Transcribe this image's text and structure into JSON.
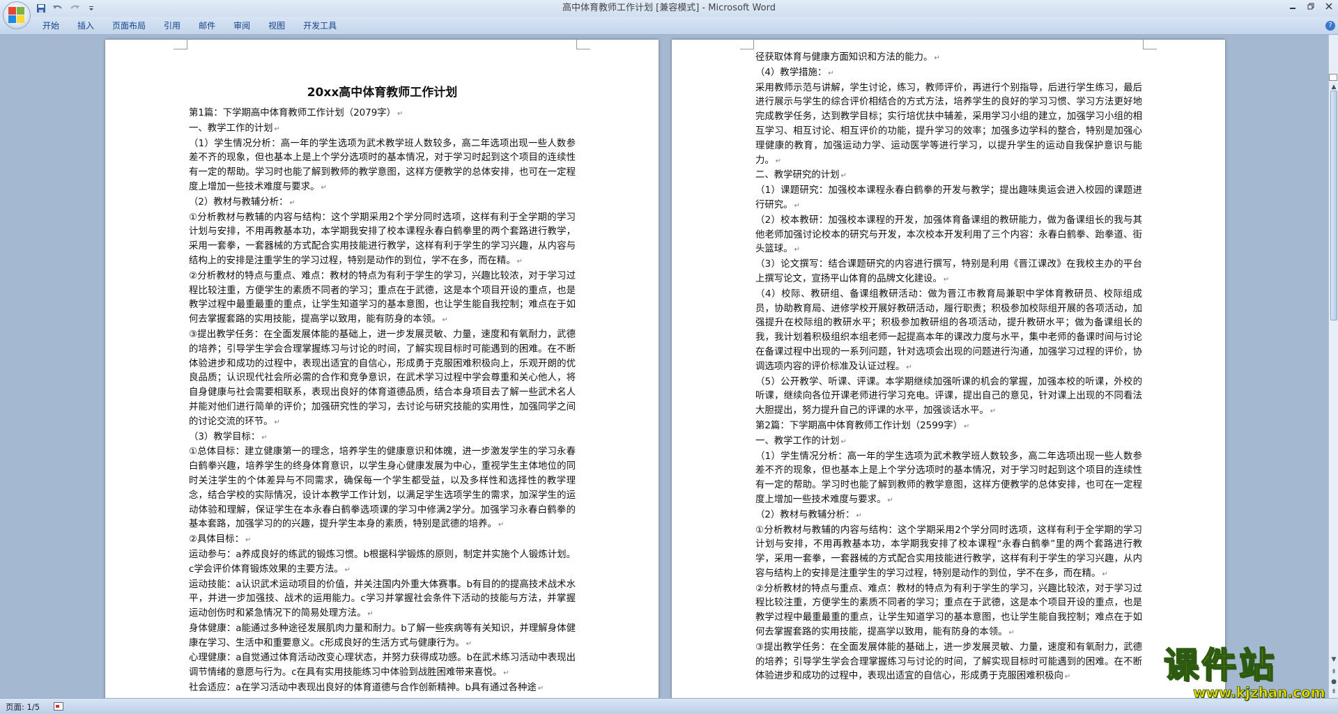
{
  "window": {
    "title": "高中体育教师工作计划 [兼容模式] - Microsoft Word"
  },
  "ribbon": {
    "tabs": [
      "开始",
      "插入",
      "页面布局",
      "引用",
      "邮件",
      "审阅",
      "视图",
      "开发工具"
    ]
  },
  "quick_access": {
    "icons": [
      "save-icon",
      "undo-icon",
      "redo-icon",
      "customize-icon"
    ]
  },
  "status": {
    "page": "页面: 1/5"
  },
  "watermark": {
    "main": "课件站",
    "url": "www.kjzhan.com"
  },
  "doc": {
    "left": {
      "title": "20xx高中体育教师工作计划",
      "paragraphs": [
        "第1篇：下学期高中体育教师工作计划（2079字）",
        "一、教学工作的计划",
        "（1）学生情况分析：高一年的学生选项为武术教学班人数较多，高二年选项出现一些人数参差不齐的现象，但也基本上是上个学分选项时的基本情况，对于学习时起到这个项目的连续性有一定的帮助。学习时也能了解到教师的教学意图，这样方便教学的总体安排，也可在一定程度上增加一些技术难度与要求。",
        "（2）教材与教辅分析：",
        "①分析教材与教辅的内容与结构：这个学期采用2个学分同时选项，这样有利于全学期的学习计划与安排，不用再教基本功，本学期我安排了校本课程永春白鹤拳里的两个套路进行教学，采用一套拳，一套器械的方式配合实用技能进行教学，这样有利于学生的学习兴趣，从内容与结构上的安排是注重学生的学习过程，特别是动作的到位，学不在多，而在精。",
        "②分析教材的特点与重点、难点：教材的特点为有利于学生的学习，兴趣比较浓，对于学习过程比较注重，方便学生的素质不同者的学习；重点在于武德，这是本个项目开设的重点，也是教学过程中最重最重的重点，让学生知道学习的基本意图，也让学生能自我控制；难点在于如何去掌握套路的实用技能，提高学以致用，能有防身的本领。",
        "③提出教学任务：在全面发展体能的基础上，进一步发展灵敏、力量，速度和有氧耐力，武德的培养；引导学生学会合理掌握练习与讨论的时间，了解实现目标时可能遇到的困难。在不断体验进步和成功的过程中，表现出适宜的自信心，形成勇于克服困难积极向上，乐观开朗的优良品质；认识现代社会所必需的合作和竞争意识，在武术学习过程中学会尊重和关心他人，将自身健康与社会需要相联系，表现出良好的体育道德品质，结合本身项目去了解一些武术名人并能对他们进行简单的评价；加强研究性的学习，去讨论与研究技能的实用性，加强同学之间的讨论交流的环节。",
        "（3）教学目标：",
        "①总体目标：建立健康第一的理念，培养学生的健康意识和体魄，进一步激发学生的学习永春白鹤拳兴趣，培养学生的终身体育意识，以学生身心健康发展为中心，重视学生主体地位的同时关注学生的个体差异与不同需求，确保每一个学生都受益，以及多样性和选择性的教学理念，结合学校的实际情况，设计本教学工作计划，以满足学生选项学生的需求，加深学生的运动体验和理解，保证学生在本永春白鹤拳选项课的学习中修满2学分。加强学习永春白鹤拳的基本套路，加强学习的的兴趣，提升学生本身的素质，特别是武德的培养。",
        "②具体目标：",
        "运动参与：a养成良好的练武的锻炼习惯。b根据科学锻炼的原则，制定并实施个人锻炼计划。c学会评价体育锻炼效果的主要方法。",
        "运动技能：a认识武术运动项目的价值，并关注国内外重大体赛事。b有目的的提高技术战术水平，并进一步加强技、战术的运用能力。c学习并掌握社会条件下活动的技能与方法，并掌握运动创伤时和紧急情况下的简易处理方法。",
        "身体健康：a能通过多种途径发展肌肉力量和耐力。b了解一些疾病等有关知识，并理解身体健康在学习、生活中和重要意义。c形成良好的生活方式与健康行为。",
        "心理健康：a自觉通过体育活动改变心理状态，并努力获得成功感。b在武术练习活动中表现出调节情绪的意愿与行为。c在具有实用技能练习中体验到战胜困难带来喜悦。",
        "社会适应：a在学习活动中表现出良好的体育道德与合作创新精神。b具有通过各种途"
      ]
    },
    "right": {
      "paragraphs": [
        "径获取体育与健康方面知识和方法的能力。",
        "（4）教学措施：",
        "采用教师示范与讲解，学生讨论，练习，教师评价，再进行个别指导，后进行学生练习，最后进行展示与学生的综合评价相结合的方式方法，培养学生的良好的学习习惯、学习方法更好地完成教学任务，达到教学目标；实行培优扶中辅差，采用学习小组的建立，加强学习小组的相互学习、相互讨论、相互评价的功能，提升学习的效率；加强多边学科的整合，特别是加强心理健康的教育，加强运动力学、运动医学等进行学习，以提升学生的运动自我保护意识与能力。",
        "二、教学研究的计划",
        "（1）课题研究：加强校本课程永春白鹤拳的开发与教学；提出趣味奥运会进入校园的课题进行研究。",
        "（2）校本教研：加强校本课程的开发，加强体育备课组的教研能力，做为备课组长的我与其他老师加强讨论校本的研究与开发，本次校本开发利用了三个内容：永春白鹤拳、跆拳道、街头篮球。",
        "（3）论文撰写：结合课题研究的内容进行撰写，特别是利用《晋江课改》在我校主办的平台上撰写论文，宣扬平山体育的品牌文化建设。",
        "（4）校际、教研组、备课组教研活动：做为晋江市教育局兼职中学体育教研员、校际组成员，协助教育局、进修学校开展好教研活动，履行职责；积极参加校际组开展的各项活动，加强提升在校际组的教研水平；积极参加教研组的各项活动，提升教研水平；做为备课组长的我，我计划着积极组织本组老师一起提高本年的课改力度与水平，集中老师的备课时间与讨论在备课过程中出现的一系列问题，针对选项会出现的问题进行沟通，加强学习过程的评价，协调选项内容的评价标准及认证过程。",
        "（5）公开教学、听课、评课。本学期继续加强听课的机会的掌握，加强本校的听课，外校的听课，继续向各位开课老师进行学习充电。评课，提出自己的意见，针对课上出现的不同看法大胆提出，努力提升自己的评课的水平，加强谈话水平。",
        "第2篇：下学期高中体育教师工作计划（2599字）",
        "一、教学工作的计划",
        "（1）学生情况分析：高一年的学生选项为武术教学班人数较多，高二年选项出现一些人数参差不齐的现象，但也基本上是上个学分选项时的基本情况，对于学习时起到这个项目的连续性有一定的帮助。学习时也能了解到教师的教学意图，这样方便教学的总体安排，也可在一定程度上增加一些技术难度与要求。",
        "（2）教材与教辅分析：",
        "①分析教材与教辅的内容与结构：这个学期采用2个学分同时选项，这样有利于全学期的学习计划与安排，不用再教基本功，本学期我安排了校本课程“永春白鹤拳”里的两个套路进行教学，采用一套拳，一套器械的方式配合实用技能进行教学，这样有利于学生的学习兴趣，从内容与结构上的安排是注重学生的学习过程，特别是动作的到位，学不在多，而在精。",
        "②分析教材的特点与重点、难点：教材的特点为有利于学生的学习，兴趣比较浓，对于学习过程比较注重，方便学生的素质不同者的学习；重点在于武德，这是本个项目开设的重点，也是教学过程中最重最重的重点，让学生知道学习的基本意图，也让学生能自我控制；难点在于如何去掌握套路的实用技能，提高学以致用，能有防身的本领。",
        "③提出教学任务：在全面发展体能的基础上，进一步发展灵敏、力量，速度和有氧耐力，武德的培养；引导学生学会合理掌握练习与讨论的时间，了解实现目标时可能遇到的困难。在不断体验进步和成功的过程中，表现出适宜的自信心，形成勇于克服困难积极向"
      ]
    }
  }
}
